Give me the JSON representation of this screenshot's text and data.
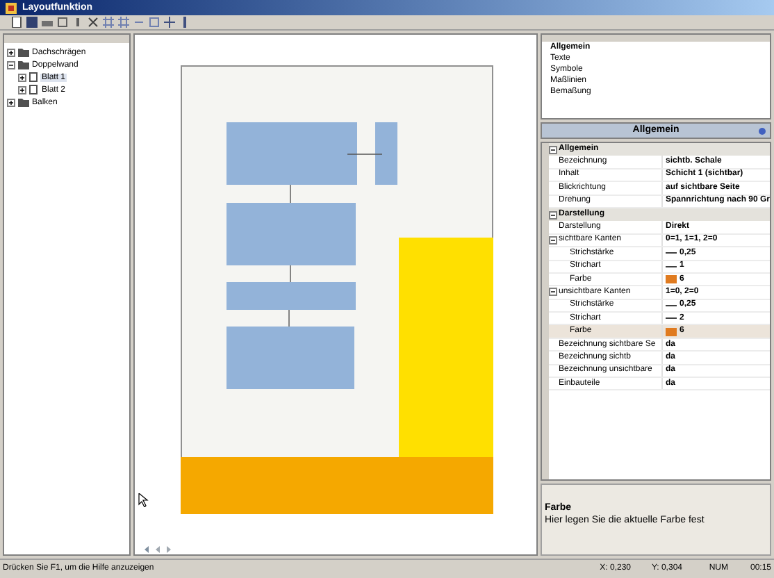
{
  "window": {
    "title": "Layoutfunktion"
  },
  "tree": [
    {
      "label": "Dachschrägen",
      "expanded": false
    },
    {
      "label": "Doppelwand",
      "expanded": true,
      "children": [
        {
          "label": "Blatt 1",
          "selected": true
        },
        {
          "label": "Blatt 2",
          "selected": false
        }
      ]
    },
    {
      "label": "Balken",
      "expanded": false
    }
  ],
  "sections": [
    {
      "label": "Allgemein",
      "selected": true
    },
    {
      "label": "Texte",
      "selected": false
    },
    {
      "label": "Symbole",
      "selected": false
    },
    {
      "label": "Maßlinien",
      "selected": false
    },
    {
      "label": "Bemaßung",
      "selected": false
    }
  ],
  "panel_title": "Allgemein",
  "properties": [
    {
      "label": "Allgemein",
      "expanded": true,
      "children": [
        {
          "label": "Bezeichnung",
          "value": "sichtb. Schale",
          "selected": false
        },
        {
          "label": "Inhalt",
          "value": "Schicht 1 (sichtbar)",
          "selected": false
        },
        {
          "label": "Blickrichtung",
          "value": "auf sichtbare Seite",
          "selected": false
        },
        {
          "label": "Drehung",
          "value": "Spannrichtung nach 90 Gr",
          "selected": false
        }
      ]
    },
    {
      "label": "Darstellung",
      "expanded": true,
      "children": [
        {
          "label": "Darstellung",
          "value": "Direkt",
          "selected": false
        },
        {
          "label": "sichtbare Kanten",
          "value": "0=1, 1=1, 2=0",
          "selected": false,
          "expanded": true,
          "children": [
            {
              "label": "Strichstärke",
              "value": "0,25",
              "kind": "line",
              "selected": false
            },
            {
              "label": "Strichart",
              "value": "1",
              "kind": "line",
              "selected": false
            },
            {
              "label": "Farbe",
              "value": "6",
              "kind": "color",
              "color": "#e07b20",
              "selected": false
            }
          ]
        },
        {
          "label": "unsichtbare Kanten",
          "value": "1=0, 2=0",
          "selected": false,
          "expanded": true,
          "children": [
            {
              "label": "Strichstärke",
              "value": "0,25",
              "kind": "line",
              "selected": false
            },
            {
              "label": "Strichart",
              "value": "2",
              "kind": "line",
              "selected": false
            },
            {
              "label": "Farbe",
              "value": "6",
              "kind": "color",
              "color": "#e07b20",
              "selected": true
            }
          ]
        },
        {
          "label": "Bezeichnung sichtbare Se",
          "value": "da",
          "selected": false
        },
        {
          "label": "Bezeichnung sichtb",
          "value": "da",
          "selected": false
        },
        {
          "label": "Bezeichnung unsichtbare",
          "value": "da",
          "selected": false
        },
        {
          "label": "Einbauteile",
          "value": "da",
          "selected": false
        }
      ]
    }
  ],
  "description": {
    "title": "Farbe",
    "text": "Hier legen Sie die aktuelle Farbe fest"
  },
  "status_bar": {
    "message": "Drücken Sie F1, um die Hilfe anzuzeigen",
    "x": "X: 0,230",
    "y": "Y: 0,304",
    "num": "NUM",
    "time": "00:15"
  }
}
